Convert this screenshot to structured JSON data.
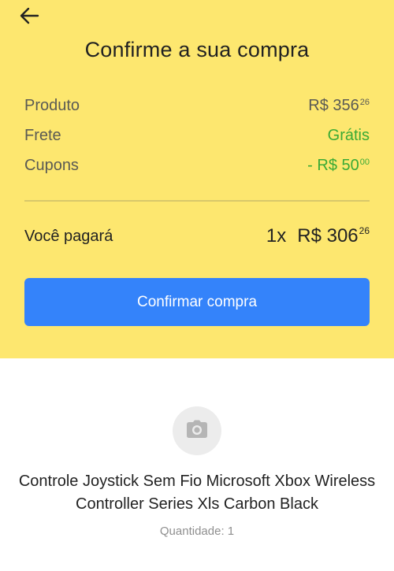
{
  "header": {
    "title": "Confirme a sua compra"
  },
  "summary": {
    "rows": [
      {
        "label": "Produto",
        "value": "R$ 356",
        "cents": "26",
        "color": "#5a5a54"
      },
      {
        "label": "Frete",
        "value": "Grátis",
        "cents": "",
        "color": "#3aaa35"
      },
      {
        "label": "Cupons",
        "value": "- R$ 50",
        "cents": "00",
        "color": "#3aaa35"
      }
    ]
  },
  "payment": {
    "label": "Você pagará",
    "quantity": "1x",
    "amount": "R$ 306",
    "cents": "26"
  },
  "actions": {
    "confirm_label": "Confirmar compra"
  },
  "product": {
    "image_icon": "camera-icon",
    "name": "Controle Joystick Sem Fio Microsoft Xbox Wireless Controller Series Xls Carbon Black",
    "quantity_text": "Quantidade: 1"
  },
  "colors": {
    "header_bg": "#fde76f",
    "accent": "#3483fa",
    "discount": "#3aaa35"
  }
}
